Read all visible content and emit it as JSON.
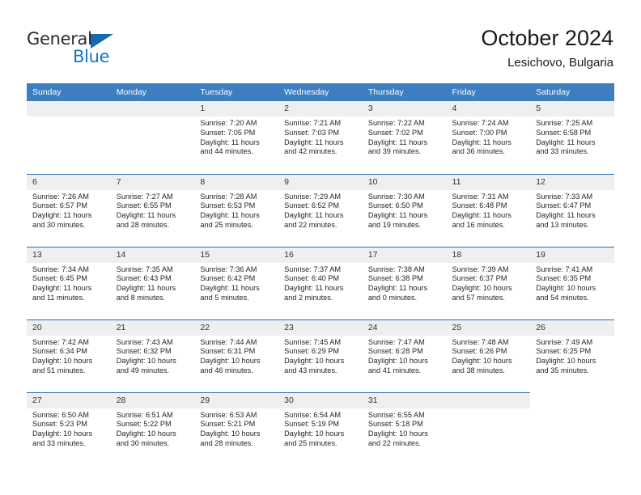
{
  "brand": {
    "name_top": "General",
    "name_bottom": "Blue",
    "accent_color": "#1676c4",
    "triangle_color": "#1569b0"
  },
  "header": {
    "title": "October 2024",
    "subtitle": "Lesichovo, Bulgaria"
  },
  "theme": {
    "header_row_bg": "#3c7ebf",
    "week_divider": "#2f6da8",
    "daynum_bg": "#efefef",
    "text_color": "#262626"
  },
  "weekday_headers": [
    "Sunday",
    "Monday",
    "Tuesday",
    "Wednesday",
    "Thursday",
    "Friday",
    "Saturday"
  ],
  "labels": {
    "sunrise_prefix": "Sunrise:",
    "sunset_prefix": "Sunset:",
    "daylight_prefix": "Daylight:"
  },
  "weeks": [
    [
      {
        "day": "",
        "blank": true,
        "offgrid": false,
        "line1": "",
        "line2": "",
        "line3": "",
        "line4": ""
      },
      {
        "day": "",
        "blank": true,
        "offgrid": false,
        "line1": "",
        "line2": "",
        "line3": "",
        "line4": ""
      },
      {
        "day": "1",
        "blank": false,
        "offgrid": false,
        "line1": "Sunrise: 7:20 AM",
        "line2": "Sunset: 7:05 PM",
        "line3": "Daylight: 11 hours",
        "line4": "and 44 minutes."
      },
      {
        "day": "2",
        "blank": false,
        "offgrid": false,
        "line1": "Sunrise: 7:21 AM",
        "line2": "Sunset: 7:03 PM",
        "line3": "Daylight: 11 hours",
        "line4": "and 42 minutes."
      },
      {
        "day": "3",
        "blank": false,
        "offgrid": false,
        "line1": "Sunrise: 7:22 AM",
        "line2": "Sunset: 7:02 PM",
        "line3": "Daylight: 11 hours",
        "line4": "and 39 minutes."
      },
      {
        "day": "4",
        "blank": false,
        "offgrid": false,
        "line1": "Sunrise: 7:24 AM",
        "line2": "Sunset: 7:00 PM",
        "line3": "Daylight: 11 hours",
        "line4": "and 36 minutes."
      },
      {
        "day": "5",
        "blank": false,
        "offgrid": false,
        "line1": "Sunrise: 7:25 AM",
        "line2": "Sunset: 6:58 PM",
        "line3": "Daylight: 11 hours",
        "line4": "and 33 minutes."
      }
    ],
    [
      {
        "day": "6",
        "blank": false,
        "offgrid": false,
        "line1": "Sunrise: 7:26 AM",
        "line2": "Sunset: 6:57 PM",
        "line3": "Daylight: 11 hours",
        "line4": "and 30 minutes."
      },
      {
        "day": "7",
        "blank": false,
        "offgrid": false,
        "line1": "Sunrise: 7:27 AM",
        "line2": "Sunset: 6:55 PM",
        "line3": "Daylight: 11 hours",
        "line4": "and 28 minutes."
      },
      {
        "day": "8",
        "blank": false,
        "offgrid": false,
        "line1": "Sunrise: 7:28 AM",
        "line2": "Sunset: 6:53 PM",
        "line3": "Daylight: 11 hours",
        "line4": "and 25 minutes."
      },
      {
        "day": "9",
        "blank": false,
        "offgrid": false,
        "line1": "Sunrise: 7:29 AM",
        "line2": "Sunset: 6:52 PM",
        "line3": "Daylight: 11 hours",
        "line4": "and 22 minutes."
      },
      {
        "day": "10",
        "blank": false,
        "offgrid": false,
        "line1": "Sunrise: 7:30 AM",
        "line2": "Sunset: 6:50 PM",
        "line3": "Daylight: 11 hours",
        "line4": "and 19 minutes."
      },
      {
        "day": "11",
        "blank": false,
        "offgrid": false,
        "line1": "Sunrise: 7:31 AM",
        "line2": "Sunset: 6:48 PM",
        "line3": "Daylight: 11 hours",
        "line4": "and 16 minutes."
      },
      {
        "day": "12",
        "blank": false,
        "offgrid": false,
        "line1": "Sunrise: 7:33 AM",
        "line2": "Sunset: 6:47 PM",
        "line3": "Daylight: 11 hours",
        "line4": "and 13 minutes."
      }
    ],
    [
      {
        "day": "13",
        "blank": false,
        "offgrid": false,
        "line1": "Sunrise: 7:34 AM",
        "line2": "Sunset: 6:45 PM",
        "line3": "Daylight: 11 hours",
        "line4": "and 11 minutes."
      },
      {
        "day": "14",
        "blank": false,
        "offgrid": false,
        "line1": "Sunrise: 7:35 AM",
        "line2": "Sunset: 6:43 PM",
        "line3": "Daylight: 11 hours",
        "line4": "and 8 minutes."
      },
      {
        "day": "15",
        "blank": false,
        "offgrid": false,
        "line1": "Sunrise: 7:36 AM",
        "line2": "Sunset: 6:42 PM",
        "line3": "Daylight: 11 hours",
        "line4": "and 5 minutes."
      },
      {
        "day": "16",
        "blank": false,
        "offgrid": false,
        "line1": "Sunrise: 7:37 AM",
        "line2": "Sunset: 6:40 PM",
        "line3": "Daylight: 11 hours",
        "line4": "and 2 minutes."
      },
      {
        "day": "17",
        "blank": false,
        "offgrid": false,
        "line1": "Sunrise: 7:38 AM",
        "line2": "Sunset: 6:38 PM",
        "line3": "Daylight: 11 hours",
        "line4": "and 0 minutes."
      },
      {
        "day": "18",
        "blank": false,
        "offgrid": false,
        "line1": "Sunrise: 7:39 AM",
        "line2": "Sunset: 6:37 PM",
        "line3": "Daylight: 10 hours",
        "line4": "and 57 minutes."
      },
      {
        "day": "19",
        "blank": false,
        "offgrid": false,
        "line1": "Sunrise: 7:41 AM",
        "line2": "Sunset: 6:35 PM",
        "line3": "Daylight: 10 hours",
        "line4": "and 54 minutes."
      }
    ],
    [
      {
        "day": "20",
        "blank": false,
        "offgrid": false,
        "line1": "Sunrise: 7:42 AM",
        "line2": "Sunset: 6:34 PM",
        "line3": "Daylight: 10 hours",
        "line4": "and 51 minutes."
      },
      {
        "day": "21",
        "blank": false,
        "offgrid": false,
        "line1": "Sunrise: 7:43 AM",
        "line2": "Sunset: 6:32 PM",
        "line3": "Daylight: 10 hours",
        "line4": "and 49 minutes."
      },
      {
        "day": "22",
        "blank": false,
        "offgrid": false,
        "line1": "Sunrise: 7:44 AM",
        "line2": "Sunset: 6:31 PM",
        "line3": "Daylight: 10 hours",
        "line4": "and 46 minutes."
      },
      {
        "day": "23",
        "blank": false,
        "offgrid": false,
        "line1": "Sunrise: 7:45 AM",
        "line2": "Sunset: 6:29 PM",
        "line3": "Daylight: 10 hours",
        "line4": "and 43 minutes."
      },
      {
        "day": "24",
        "blank": false,
        "offgrid": false,
        "line1": "Sunrise: 7:47 AM",
        "line2": "Sunset: 6:28 PM",
        "line3": "Daylight: 10 hours",
        "line4": "and 41 minutes."
      },
      {
        "day": "25",
        "blank": false,
        "offgrid": false,
        "line1": "Sunrise: 7:48 AM",
        "line2": "Sunset: 6:26 PM",
        "line3": "Daylight: 10 hours",
        "line4": "and 38 minutes."
      },
      {
        "day": "26",
        "blank": false,
        "offgrid": false,
        "line1": "Sunrise: 7:49 AM",
        "line2": "Sunset: 6:25 PM",
        "line3": "Daylight: 10 hours",
        "line4": "and 35 minutes."
      }
    ],
    [
      {
        "day": "27",
        "blank": false,
        "offgrid": false,
        "line1": "Sunrise: 6:50 AM",
        "line2": "Sunset: 5:23 PM",
        "line3": "Daylight: 10 hours",
        "line4": "and 33 minutes."
      },
      {
        "day": "28",
        "blank": false,
        "offgrid": false,
        "line1": "Sunrise: 6:51 AM",
        "line2": "Sunset: 5:22 PM",
        "line3": "Daylight: 10 hours",
        "line4": "and 30 minutes."
      },
      {
        "day": "29",
        "blank": false,
        "offgrid": false,
        "line1": "Sunrise: 6:53 AM",
        "line2": "Sunset: 5:21 PM",
        "line3": "Daylight: 10 hours",
        "line4": "and 28 minutes."
      },
      {
        "day": "30",
        "blank": false,
        "offgrid": false,
        "line1": "Sunrise: 6:54 AM",
        "line2": "Sunset: 5:19 PM",
        "line3": "Daylight: 10 hours",
        "line4": "and 25 minutes."
      },
      {
        "day": "31",
        "blank": false,
        "offgrid": false,
        "line1": "Sunrise: 6:55 AM",
        "line2": "Sunset: 5:18 PM",
        "line3": "Daylight: 10 hours",
        "line4": "and 22 minutes."
      },
      {
        "day": "",
        "blank": true,
        "offgrid": false,
        "line1": "",
        "line2": "",
        "line3": "",
        "line4": ""
      },
      {
        "day": "",
        "blank": true,
        "offgrid": true,
        "line1": "",
        "line2": "",
        "line3": "",
        "line4": ""
      }
    ]
  ]
}
